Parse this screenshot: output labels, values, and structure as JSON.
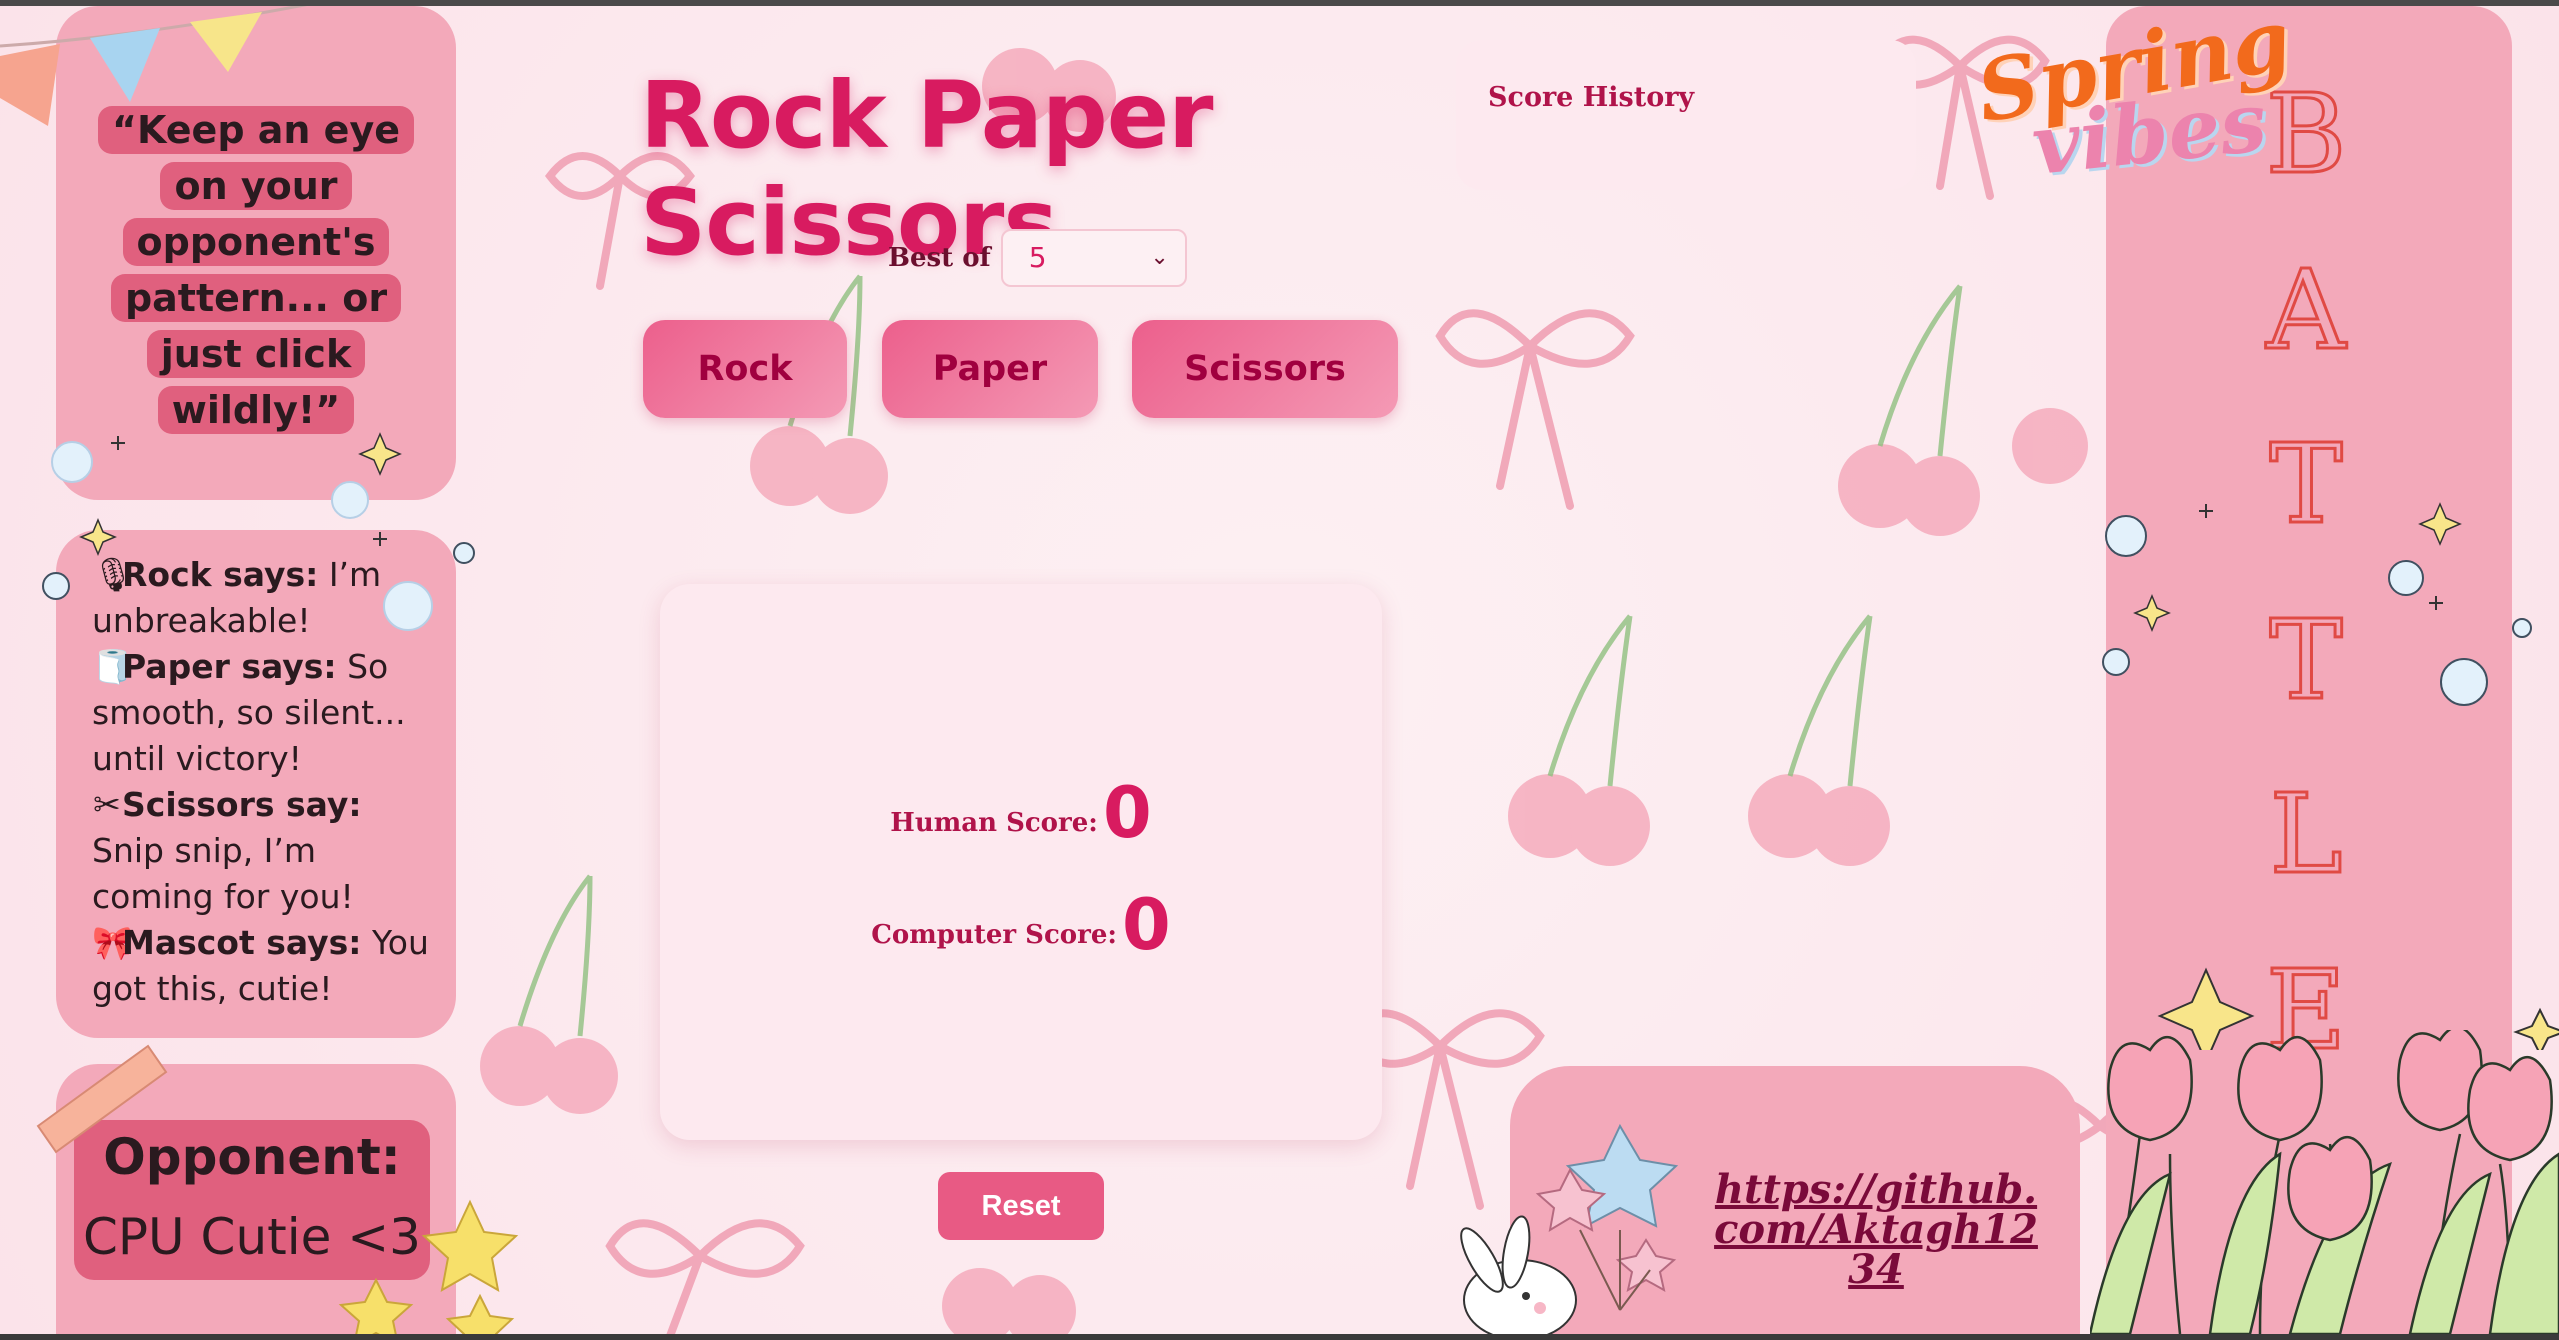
{
  "quote": {
    "text": "“Keep an eye on your opponent's pattern... or just click wildly!”"
  },
  "says": [
    {
      "icon": "microphone-icon",
      "glyph": "🎙",
      "who": "Rock says:",
      "line": " I’m unbreakable!"
    },
    {
      "icon": "paper-roll-icon",
      "glyph": "🧻",
      "who": "Paper says:",
      "line": " So smooth, so silent... until victory!"
    },
    {
      "icon": "scissors-icon",
      "glyph": "✂",
      "who": "Scissors say:",
      "line": " Snip snip, I’m coming for you!"
    },
    {
      "icon": "ribbon-icon",
      "glyph": "🎀",
      "who": "Mascot says:",
      "line": " You got this, cutie!"
    }
  ],
  "opponent": {
    "title": "Opponent:",
    "name": "CPU Cutie <3"
  },
  "game": {
    "title": "Rock Paper Scissors",
    "best_of_label": "Best of",
    "best_of_value": "5",
    "buttons": {
      "rock": "Rock",
      "paper": "Paper",
      "scissors": "Scissors"
    },
    "human_score_label": "Human Score:",
    "human_score": "0",
    "computer_score_label": "Computer Score:",
    "computer_score": "0",
    "reset_label": "Reset"
  },
  "history": {
    "title": "Score History"
  },
  "logo": {
    "line1": "Spring",
    "line2": "vibes"
  },
  "battle": {
    "letters": [
      "B",
      "A",
      "T",
      "T",
      "L",
      "E"
    ]
  },
  "link": {
    "text": "https://github.com/Aktagh1234"
  },
  "colors": {
    "accent": "#d81b60",
    "card": "#f3a9ba",
    "button": "#ec5f8c",
    "panel": "#fde9ef"
  }
}
